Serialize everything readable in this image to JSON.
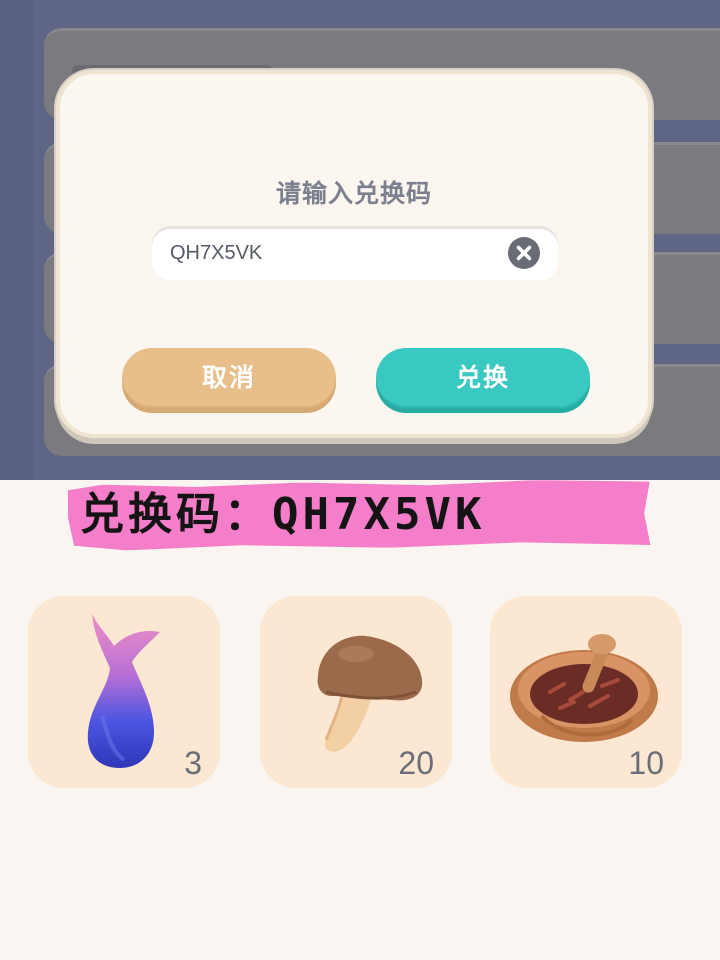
{
  "dialog": {
    "title": "请输入兑换码",
    "code_value": "QH7X5VK",
    "cancel_label": "取消",
    "confirm_label": "兑换"
  },
  "banner": {
    "text": "兑换码：QH7X5VK"
  },
  "rewards": [
    {
      "icon": "mermaid-tail-icon",
      "count": "3"
    },
    {
      "icon": "mushroom-icon",
      "count": "20"
    },
    {
      "icon": "pie-dish-icon",
      "count": "10"
    }
  ],
  "colors": {
    "cancel_button": "#e8be8a",
    "confirm_button": "#3ac9c0",
    "banner": "#f47ec9",
    "overlay": "#5f6685"
  }
}
